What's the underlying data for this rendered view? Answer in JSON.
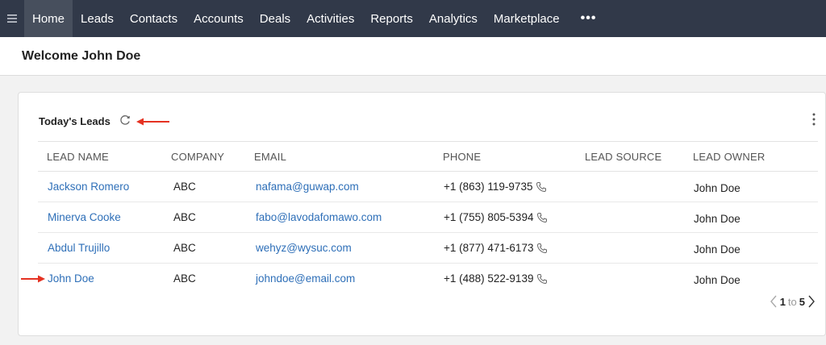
{
  "nav": {
    "items": [
      "Home",
      "Leads",
      "Contacts",
      "Accounts",
      "Deals",
      "Activities",
      "Reports",
      "Analytics",
      "Marketplace"
    ],
    "active": "Home",
    "more_label": "•••"
  },
  "welcome": {
    "title": "Welcome John Doe"
  },
  "card": {
    "title": "Today's Leads",
    "columns": [
      "LEAD NAME",
      "COMPANY",
      "EMAIL",
      "PHONE",
      "LEAD SOURCE",
      "LEAD OWNER"
    ],
    "rows": [
      {
        "name": "Jackson Romero",
        "company": "ABC",
        "email": "nafama@guwap.com",
        "phone": "+1 (863) 119-9735",
        "source": "",
        "owner": "John Doe"
      },
      {
        "name": "Minerva Cooke",
        "company": "ABC",
        "email": "fabo@lavodafomawo.com",
        "phone": "+1 (755) 805-5394",
        "source": "",
        "owner": "John Doe"
      },
      {
        "name": "Abdul Trujillo",
        "company": "ABC",
        "email": "wehyz@wysuc.com",
        "phone": "+1 (877) 471-6173",
        "source": "",
        "owner": "John Doe"
      },
      {
        "name": "John Doe",
        "company": "ABC",
        "email": "johndoe@email.com",
        "phone": "+1 (488) 522-9139",
        "source": "",
        "owner": "John Doe"
      }
    ],
    "pager": {
      "from": "1",
      "to_label": "to",
      "to": "5"
    }
  },
  "colors": {
    "nav_bg": "#313949",
    "link": "#2e6fb8",
    "annotation_arrow": "#e53222"
  }
}
